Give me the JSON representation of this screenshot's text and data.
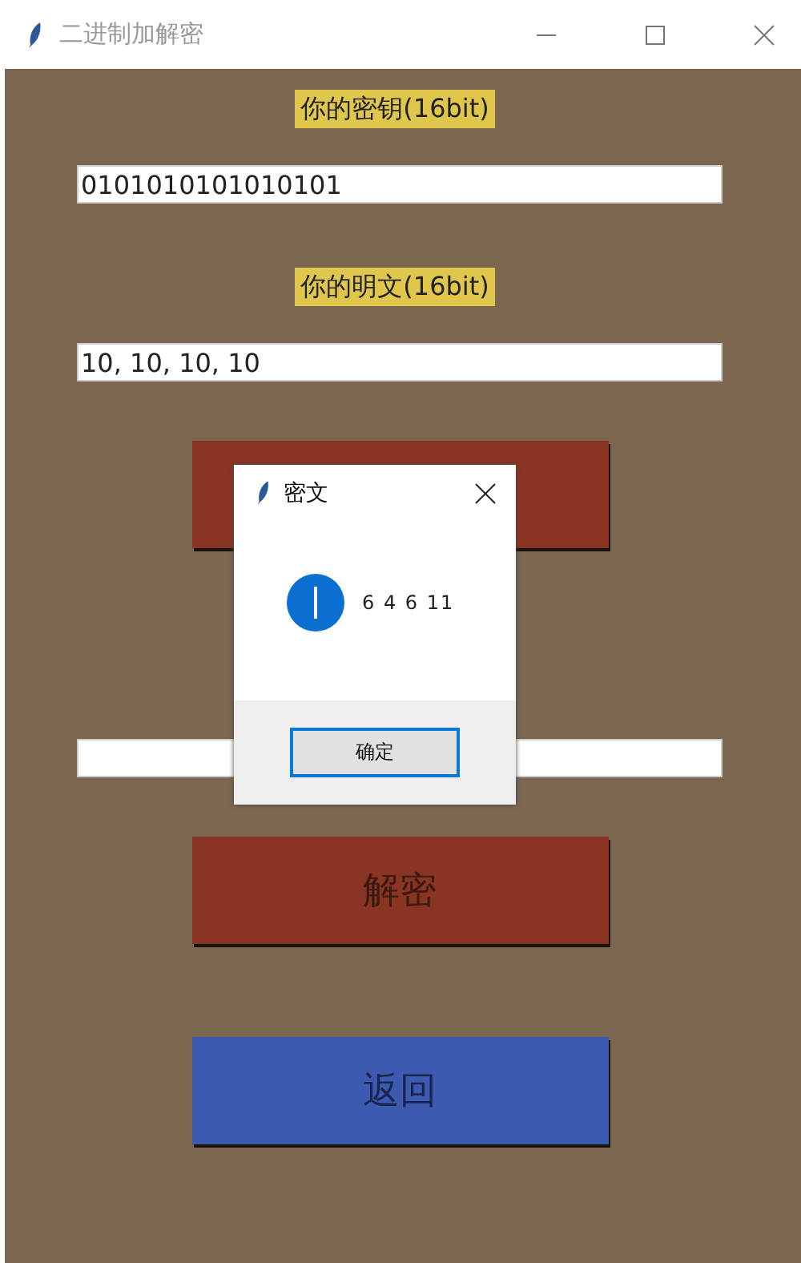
{
  "window": {
    "title": "二进制加解密"
  },
  "key_label": "你的密钥(16bit)",
  "key_input": {
    "value": "0101010101010101"
  },
  "plaintext_label": "你的明文(16bit)",
  "plaintext_input": {
    "value": "10, 10, 10, 10"
  },
  "buttons": [
    {
      "kind": "covered"
    },
    {
      "kind": "red",
      "label": "解密"
    },
    {
      "kind": "blue",
      "label": "返回"
    }
  ],
  "dialog": {
    "title": "密文",
    "message": "6 4 6 11",
    "ok_button": "确定"
  }
}
